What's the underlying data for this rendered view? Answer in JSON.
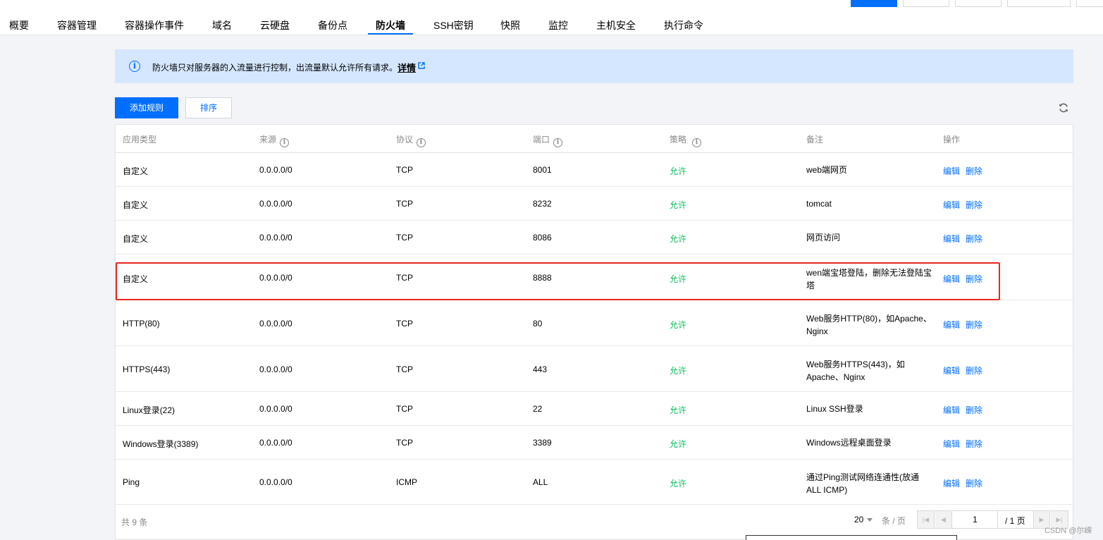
{
  "tabs": [
    {
      "label": "概要",
      "active": false
    },
    {
      "label": "容器管理",
      "active": false
    },
    {
      "label": "容器操作事件",
      "active": false
    },
    {
      "label": "域名",
      "active": false
    },
    {
      "label": "云硬盘",
      "active": false
    },
    {
      "label": "备份点",
      "active": false
    },
    {
      "label": "防火墙",
      "active": true
    },
    {
      "label": "SSH密钥",
      "active": false
    },
    {
      "label": "快照",
      "active": false
    },
    {
      "label": "监控",
      "active": false
    },
    {
      "label": "主机安全",
      "active": false
    },
    {
      "label": "执行命令",
      "active": false
    }
  ],
  "notice": {
    "text": "防火墙只对服务器的入流量进行控制，出流量默认允许所有请求。",
    "link": "详情"
  },
  "toolbar": {
    "add_label": "添加规则",
    "sort_label": "排序"
  },
  "table": {
    "headers": {
      "app_type": "应用类型",
      "source": "来源",
      "protocol": "协议",
      "port": "端口",
      "policy": "策略",
      "remark": "备注",
      "action": "操作"
    },
    "edit_label": "编辑",
    "delete_label": "删除",
    "rows": [
      {
        "app_type": "自定义",
        "source": "0.0.0.0/0",
        "protocol": "TCP",
        "port": "8001",
        "policy": "允许",
        "remark": "web端网页"
      },
      {
        "app_type": "自定义",
        "source": "0.0.0.0/0",
        "protocol": "TCP",
        "port": "8232",
        "policy": "允许",
        "remark": "tomcat"
      },
      {
        "app_type": "自定义",
        "source": "0.0.0.0/0",
        "protocol": "TCP",
        "port": "8086",
        "policy": "允许",
        "remark": "网页访问"
      },
      {
        "app_type": "自定义",
        "source": "0.0.0.0/0",
        "protocol": "TCP",
        "port": "8888",
        "policy": "允许",
        "remark": "wen端宝塔登陆，删除无法登陆宝塔"
      },
      {
        "app_type": "HTTP(80)",
        "source": "0.0.0.0/0",
        "protocol": "TCP",
        "port": "80",
        "policy": "允许",
        "remark": "Web服务HTTP(80)，如Apache、Nginx"
      },
      {
        "app_type": "HTTPS(443)",
        "source": "0.0.0.0/0",
        "protocol": "TCP",
        "port": "443",
        "policy": "允许",
        "remark": "Web服务HTTPS(443)，如Apache、Nginx"
      },
      {
        "app_type": "Linux登录(22)",
        "source": "0.0.0.0/0",
        "protocol": "TCP",
        "port": "22",
        "policy": "允许",
        "remark": "Linux SSH登录"
      },
      {
        "app_type": "Windows登录(3389)",
        "source": "0.0.0.0/0",
        "protocol": "TCP",
        "port": "3389",
        "policy": "允许",
        "remark": "Windows远程桌面登录"
      },
      {
        "app_type": "Ping",
        "source": "0.0.0.0/0",
        "protocol": "ICMP",
        "port": "ALL",
        "policy": "允许",
        "remark": "通过Ping测试网络连通性(放通ALL ICMP)"
      }
    ]
  },
  "pagination": {
    "total": "共 9 条",
    "page_size": "20",
    "per_page_unit": "条 / 页",
    "current_page": "1",
    "total_pages": "/ 1 页"
  },
  "watermark": "CSDN @尔嵘",
  "colors": {
    "accent": "#006eff",
    "allow": "#0abf5b",
    "highlight": "#e8271e",
    "notice_bg": "#d5e7ff"
  }
}
